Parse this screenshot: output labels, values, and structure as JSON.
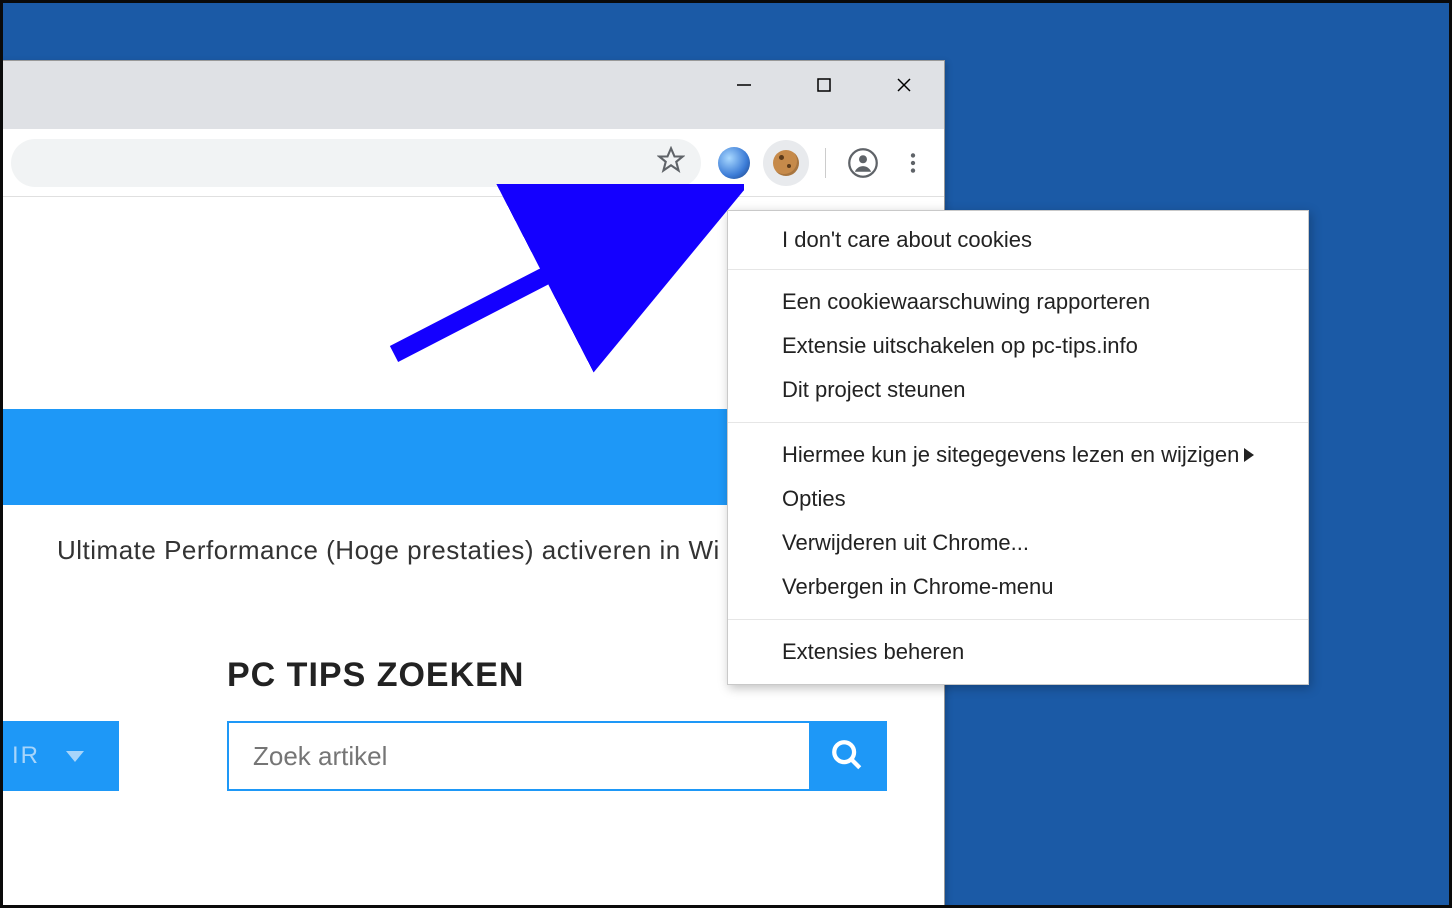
{
  "window": {
    "minimize_name": "minimize",
    "maximize_name": "maximize",
    "close_name": "close"
  },
  "toolbar": {
    "star_name": "bookmark-star",
    "ext_globe_name": "globe-extension",
    "ext_cookie_name": "cookie-extension",
    "profile_name": "profile",
    "menu_name": "browser-menu"
  },
  "page": {
    "article_title": "Ultimate Performance (Hoge prestaties) activeren in Wi",
    "search_heading": "PC TIPS ZOEKEN",
    "dropdown_label": "IR",
    "search_placeholder": "Zoek artikel"
  },
  "context_menu": {
    "title": "I don't care about cookies",
    "group1": {
      "report": "Een cookiewaarschuwing rapporteren",
      "disable": "Extensie uitschakelen op pc-tips.info",
      "support": "Dit project steunen"
    },
    "group2": {
      "sitedata": "Hiermee kun je sitegegevens lezen en wijzigen",
      "options": "Opties",
      "remove": "Verwijderen uit Chrome...",
      "hide": "Verbergen in Chrome-menu"
    },
    "group3": {
      "manage": "Extensies beheren"
    }
  }
}
